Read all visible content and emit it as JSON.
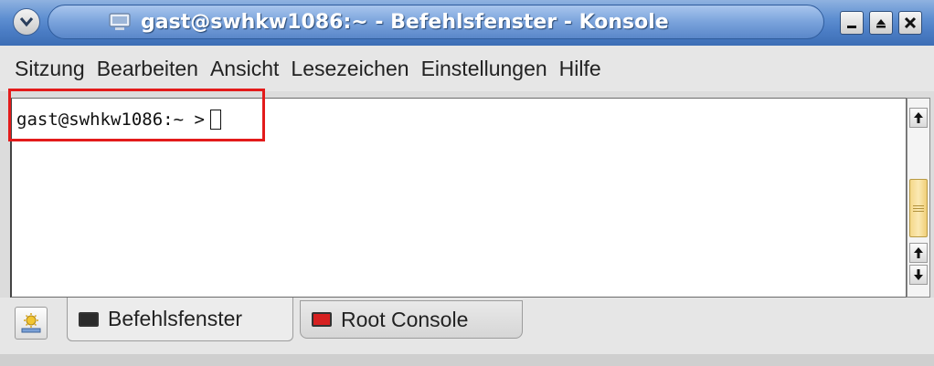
{
  "window": {
    "title": "gast@swhkw1086:~ - Befehlsfenster - Konsole"
  },
  "menu": {
    "items": [
      "Sitzung",
      "Bearbeiten",
      "Ansicht",
      "Lesezeichen",
      "Einstellungen",
      "Hilfe"
    ]
  },
  "terminal": {
    "prompt": "gast@swhkw1086:~ >"
  },
  "tabs": [
    {
      "label": "Befehlsfenster",
      "icon": "terminal-icon",
      "active": true
    },
    {
      "label": "Root Console",
      "icon": "root-terminal-icon",
      "active": false
    }
  ],
  "colors": {
    "highlight": "#e31b1b",
    "titlebar": "#4a7cc4",
    "scroll_thumb": "#f5d889",
    "root_icon": "#d62020"
  },
  "icons": {
    "window_menu": "chevron-down-icon",
    "title_app": "monitor-icon",
    "minimize": "minimize-icon",
    "maximize": "maximize-icon",
    "close": "close-icon",
    "new_session": "new-session-icon"
  }
}
